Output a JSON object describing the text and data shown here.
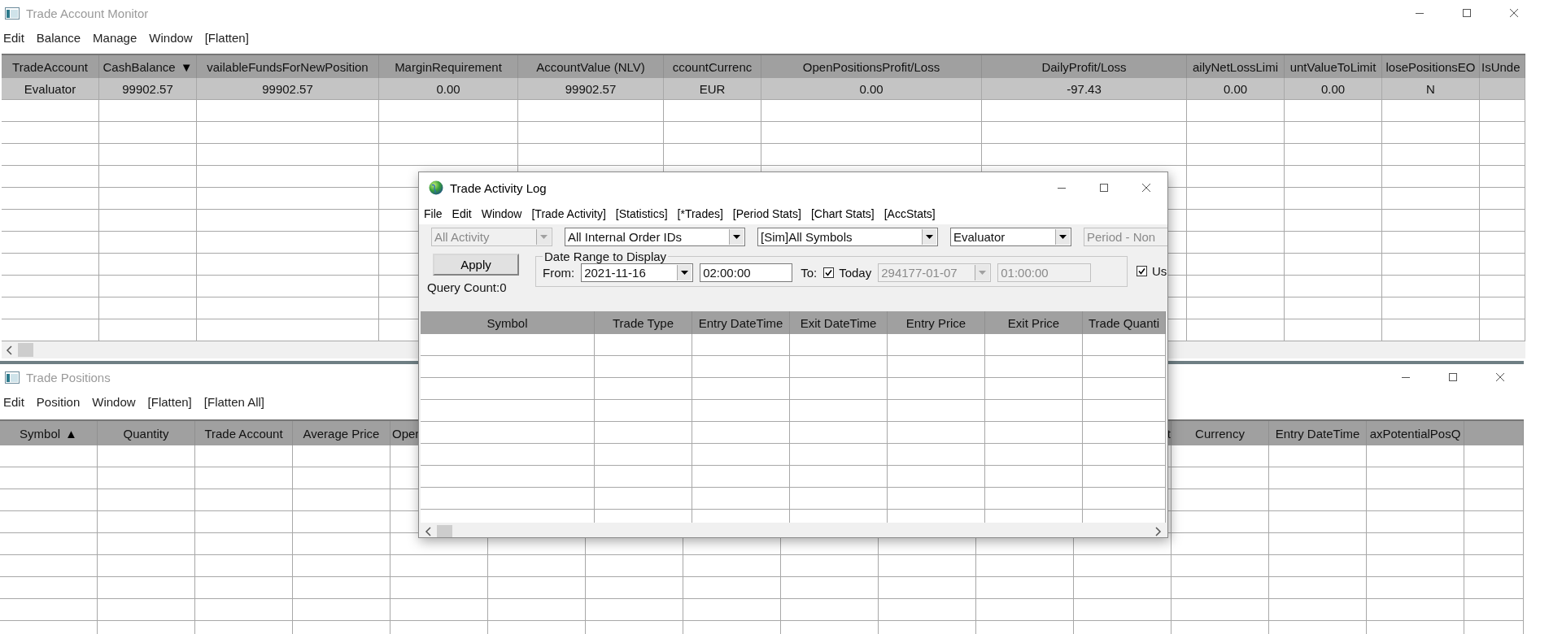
{
  "account_monitor": {
    "title": "Trade Account Monitor",
    "menu": [
      "Edit",
      "Balance",
      "Manage",
      "Window",
      "[Flatten]"
    ],
    "table": {
      "columns": [
        {
          "label": "TradeAccount"
        },
        {
          "label": "CashBalance",
          "sort_arrow": "▼"
        },
        {
          "label": "vailableFundsForNewPosition"
        },
        {
          "label": "MarginRequirement"
        },
        {
          "label": "AccountValue (NLV)"
        },
        {
          "label": "ccountCurrenc"
        },
        {
          "label": "OpenPositionsProfit/Loss"
        },
        {
          "label": "DailyProfit/Loss"
        },
        {
          "label": "ailyNetLossLimi"
        },
        {
          "label": "untValueToLimit"
        },
        {
          "label": "losePositionsEO"
        },
        {
          "label": "IsUnde"
        }
      ],
      "rows": [
        {
          "selected": true,
          "cells": [
            "Evaluator",
            "99902.57",
            "99902.57",
            "0.00",
            "99902.57",
            "EUR",
            "0.00",
            "-97.43",
            "0.00",
            "0.00",
            "N"
          ]
        }
      ]
    }
  },
  "trade_positions": {
    "title": "Trade Positions",
    "menu": [
      "Edit",
      "Position",
      "Window",
      "[Flatten]",
      "[Flatten All]"
    ],
    "table": {
      "columns_left": [
        {
          "label": "Symbol",
          "sort_arrow": "▲"
        },
        {
          "label": "Quantity"
        },
        {
          "label": "Trade Account"
        },
        {
          "label": "Average Price"
        },
        {
          "label": "Oper"
        }
      ],
      "columns_right": [
        {
          "label": "t"
        },
        {
          "label": "Currency"
        },
        {
          "label": "Entry DateTime"
        },
        {
          "label": "axPotentialPosQ"
        }
      ]
    }
  },
  "trade_activity_log": {
    "title": "Trade Activity Log",
    "menu": [
      "File",
      "Edit",
      "Window",
      "[Trade Activity]",
      "[Statistics]",
      "[*Trades]",
      "[Period Stats]",
      "[Chart Stats]",
      "[AccStats]"
    ],
    "filters": [
      {
        "kind": "combo",
        "value": "All Activity",
        "disabled": true
      },
      {
        "kind": "combo",
        "value": "All Internal Order IDs",
        "disabled": false
      },
      {
        "kind": "combo",
        "value": "[Sim]All Symbols",
        "disabled": false
      },
      {
        "kind": "combo",
        "value": "Evaluator",
        "disabled": false
      },
      {
        "kind": "field",
        "value": "Period - Non",
        "disabled": true
      }
    ],
    "apply_button": "Apply",
    "query_count": "Query Count:0",
    "date_range": {
      "legend": "Date Range to Display",
      "from_label": "From:",
      "from_date": {
        "value": "2021-11-16",
        "disabled": false
      },
      "from_time": {
        "value": "02:00:00",
        "disabled": false
      },
      "to_label": "To:",
      "today": {
        "label": "Today",
        "checked": true
      },
      "to_date": {
        "value": "294177-01-07",
        "disabled": true
      },
      "to_time": {
        "value": "01:00:00",
        "disabled": true
      }
    },
    "use_option": {
      "label": "Us",
      "checked": true
    },
    "table": {
      "columns": [
        "Symbol",
        "Trade Type",
        "Entry DateTime",
        "Exit DateTime",
        "Entry Price",
        "Exit Price",
        "Trade Quanti"
      ]
    }
  }
}
